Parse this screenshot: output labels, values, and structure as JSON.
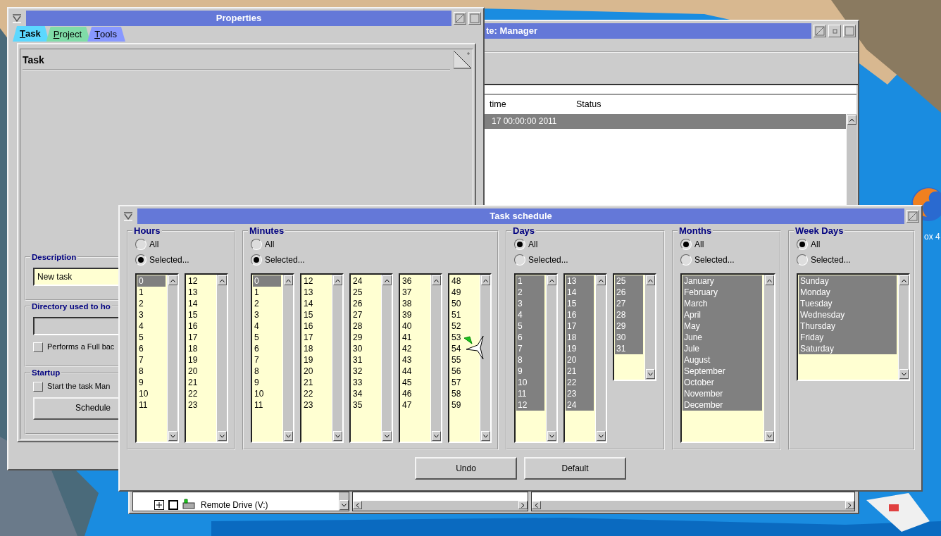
{
  "desktop": {
    "icon_label": "ox 4"
  },
  "manager": {
    "title": "te: Manager",
    "columns": [
      "time",
      "Status"
    ],
    "rows": [
      {
        "cells": [
          "17 00:00:00 2011"
        ],
        "selected": true
      }
    ],
    "tree_item": "Remote Drive (V:)"
  },
  "properties": {
    "title": "Properties",
    "tabs": [
      {
        "label": "Task",
        "selected": true,
        "color": "#5cd8ff"
      },
      {
        "label": "Project",
        "selected": false,
        "color": "#80dca8"
      },
      {
        "label": "Tools",
        "selected": false,
        "color": "#8898ff"
      }
    ],
    "panel_title": "Task",
    "description": {
      "title": "Description",
      "value": "New task"
    },
    "directory": {
      "title": "Directory used to ho",
      "checkbox": {
        "label": "Performs a Full bac",
        "checked": false
      }
    },
    "startup": {
      "title": "Startup",
      "checkbox": {
        "label": "Start the task Man",
        "checked": false
      },
      "button": "Schedule"
    }
  },
  "schedule": {
    "title": "Task schedule",
    "groups": [
      {
        "title": "Hours",
        "options": [
          {
            "label": "All",
            "selected": false
          },
          {
            "label": "Selected...",
            "selected": true
          }
        ],
        "lists": [
          {
            "items": [
              {
                "label": "0",
                "selected": true
              },
              {
                "label": "1",
                "selected": false
              },
              {
                "label": "2",
                "selected": false
              },
              {
                "label": "3",
                "selected": false
              },
              {
                "label": "4",
                "selected": false
              },
              {
                "label": "5",
                "selected": false
              },
              {
                "label": "6",
                "selected": false
              },
              {
                "label": "7",
                "selected": false
              },
              {
                "label": "8",
                "selected": false
              },
              {
                "label": "9",
                "selected": false
              },
              {
                "label": "10",
                "selected": false
              },
              {
                "label": "11",
                "selected": false
              }
            ]
          },
          {
            "items": [
              {
                "label": "12",
                "selected": false
              },
              {
                "label": "13",
                "selected": false
              },
              {
                "label": "14",
                "selected": false
              },
              {
                "label": "15",
                "selected": false
              },
              {
                "label": "16",
                "selected": false
              },
              {
                "label": "17",
                "selected": false
              },
              {
                "label": "18",
                "selected": false
              },
              {
                "label": "19",
                "selected": false
              },
              {
                "label": "20",
                "selected": false
              },
              {
                "label": "21",
                "selected": false
              },
              {
                "label": "22",
                "selected": false
              },
              {
                "label": "23",
                "selected": false
              }
            ]
          }
        ]
      },
      {
        "title": "Minutes",
        "options": [
          {
            "label": "All",
            "selected": false
          },
          {
            "label": "Selected...",
            "selected": true
          }
        ],
        "lists": [
          {
            "items": [
              {
                "label": "0",
                "selected": true
              },
              {
                "label": "1",
                "selected": false
              },
              {
                "label": "2",
                "selected": false
              },
              {
                "label": "3",
                "selected": false
              },
              {
                "label": "4",
                "selected": false
              },
              {
                "label": "5",
                "selected": false
              },
              {
                "label": "6",
                "selected": false
              },
              {
                "label": "7",
                "selected": false
              },
              {
                "label": "8",
                "selected": false
              },
              {
                "label": "9",
                "selected": false
              },
              {
                "label": "10",
                "selected": false
              },
              {
                "label": "11",
                "selected": false
              }
            ]
          },
          {
            "items": [
              {
                "label": "12",
                "selected": false
              },
              {
                "label": "13",
                "selected": false
              },
              {
                "label": "14",
                "selected": false
              },
              {
                "label": "15",
                "selected": false
              },
              {
                "label": "16",
                "selected": false
              },
              {
                "label": "17",
                "selected": false
              },
              {
                "label": "18",
                "selected": false
              },
              {
                "label": "19",
                "selected": false
              },
              {
                "label": "20",
                "selected": false
              },
              {
                "label": "21",
                "selected": false
              },
              {
                "label": "22",
                "selected": false
              },
              {
                "label": "23",
                "selected": false
              }
            ]
          },
          {
            "items": [
              {
                "label": "24",
                "selected": false
              },
              {
                "label": "25",
                "selected": false
              },
              {
                "label": "26",
                "selected": false
              },
              {
                "label": "27",
                "selected": false
              },
              {
                "label": "28",
                "selected": false
              },
              {
                "label": "29",
                "selected": false
              },
              {
                "label": "30",
                "selected": false
              },
              {
                "label": "31",
                "selected": false
              },
              {
                "label": "32",
                "selected": false
              },
              {
                "label": "33",
                "selected": false
              },
              {
                "label": "34",
                "selected": false
              },
              {
                "label": "35",
                "selected": false
              }
            ]
          },
          {
            "items": [
              {
                "label": "36",
                "selected": false
              },
              {
                "label": "37",
                "selected": false
              },
              {
                "label": "38",
                "selected": false
              },
              {
                "label": "39",
                "selected": false
              },
              {
                "label": "40",
                "selected": false
              },
              {
                "label": "41",
                "selected": false
              },
              {
                "label": "42",
                "selected": false
              },
              {
                "label": "43",
                "selected": false
              },
              {
                "label": "44",
                "selected": false
              },
              {
                "label": "45",
                "selected": false
              },
              {
                "label": "46",
                "selected": false
              },
              {
                "label": "47",
                "selected": false
              }
            ]
          },
          {
            "items": [
              {
                "label": "48",
                "selected": false
              },
              {
                "label": "49",
                "selected": false
              },
              {
                "label": "50",
                "selected": false
              },
              {
                "label": "51",
                "selected": false
              },
              {
                "label": "52",
                "selected": false
              },
              {
                "label": "53",
                "selected": false
              },
              {
                "label": "54",
                "selected": false
              },
              {
                "label": "55",
                "selected": false
              },
              {
                "label": "56",
                "selected": false
              },
              {
                "label": "57",
                "selected": false
              },
              {
                "label": "58",
                "selected": false
              },
              {
                "label": "59",
                "selected": false
              }
            ]
          }
        ]
      },
      {
        "title": "Days",
        "options": [
          {
            "label": "All",
            "selected": true
          },
          {
            "label": "Selected...",
            "selected": false
          }
        ],
        "lists": [
          {
            "items": [
              {
                "label": "1",
                "selected": true
              },
              {
                "label": "2",
                "selected": true
              },
              {
                "label": "3",
                "selected": true
              },
              {
                "label": "4",
                "selected": true
              },
              {
                "label": "5",
                "selected": true
              },
              {
                "label": "6",
                "selected": true
              },
              {
                "label": "7",
                "selected": true
              },
              {
                "label": "8",
                "selected": true
              },
              {
                "label": "9",
                "selected": true
              },
              {
                "label": "10",
                "selected": true
              },
              {
                "label": "11",
                "selected": true
              },
              {
                "label": "12",
                "selected": true
              }
            ]
          },
          {
            "items": [
              {
                "label": "13",
                "selected": true
              },
              {
                "label": "14",
                "selected": true
              },
              {
                "label": "15",
                "selected": true
              },
              {
                "label": "16",
                "selected": true
              },
              {
                "label": "17",
                "selected": true
              },
              {
                "label": "18",
                "selected": true
              },
              {
                "label": "19",
                "selected": true
              },
              {
                "label": "20",
                "selected": true
              },
              {
                "label": "21",
                "selected": true
              },
              {
                "label": "22",
                "selected": true
              },
              {
                "label": "23",
                "selected": true
              },
              {
                "label": "24",
                "selected": true
              }
            ]
          },
          {
            "items": [
              {
                "label": "25",
                "selected": true
              },
              {
                "label": "26",
                "selected": true
              },
              {
                "label": "27",
                "selected": true
              },
              {
                "label": "28",
                "selected": true
              },
              {
                "label": "29",
                "selected": true
              },
              {
                "label": "30",
                "selected": true
              },
              {
                "label": "31",
                "selected": true
              }
            ]
          }
        ]
      },
      {
        "title": "Months",
        "options": [
          {
            "label": "All",
            "selected": true
          },
          {
            "label": "Selected...",
            "selected": false
          }
        ],
        "lists": [
          {
            "items": [
              {
                "label": "January",
                "selected": true
              },
              {
                "label": "February",
                "selected": true
              },
              {
                "label": "March",
                "selected": true
              },
              {
                "label": "April",
                "selected": true
              },
              {
                "label": "May",
                "selected": true
              },
              {
                "label": "June",
                "selected": true
              },
              {
                "label": "Jule",
                "selected": true
              },
              {
                "label": "August",
                "selected": true
              },
              {
                "label": "September",
                "selected": true
              },
              {
                "label": "October",
                "selected": true
              },
              {
                "label": "November",
                "selected": true
              },
              {
                "label": "December",
                "selected": true
              }
            ]
          }
        ]
      },
      {
        "title": "Week Days",
        "options": [
          {
            "label": "All",
            "selected": true
          },
          {
            "label": "Selected...",
            "selected": false
          }
        ],
        "lists": [
          {
            "items": [
              {
                "label": "Sunday",
                "selected": true
              },
              {
                "label": "Monday",
                "selected": true
              },
              {
                "label": "Tuesday",
                "selected": true
              },
              {
                "label": "Wednesday",
                "selected": true
              },
              {
                "label": "Thursday",
                "selected": true
              },
              {
                "label": "Friday",
                "selected": true
              },
              {
                "label": "Saturday",
                "selected": true
              }
            ]
          }
        ]
      }
    ],
    "buttons": [
      "Undo",
      "Default"
    ]
  }
}
